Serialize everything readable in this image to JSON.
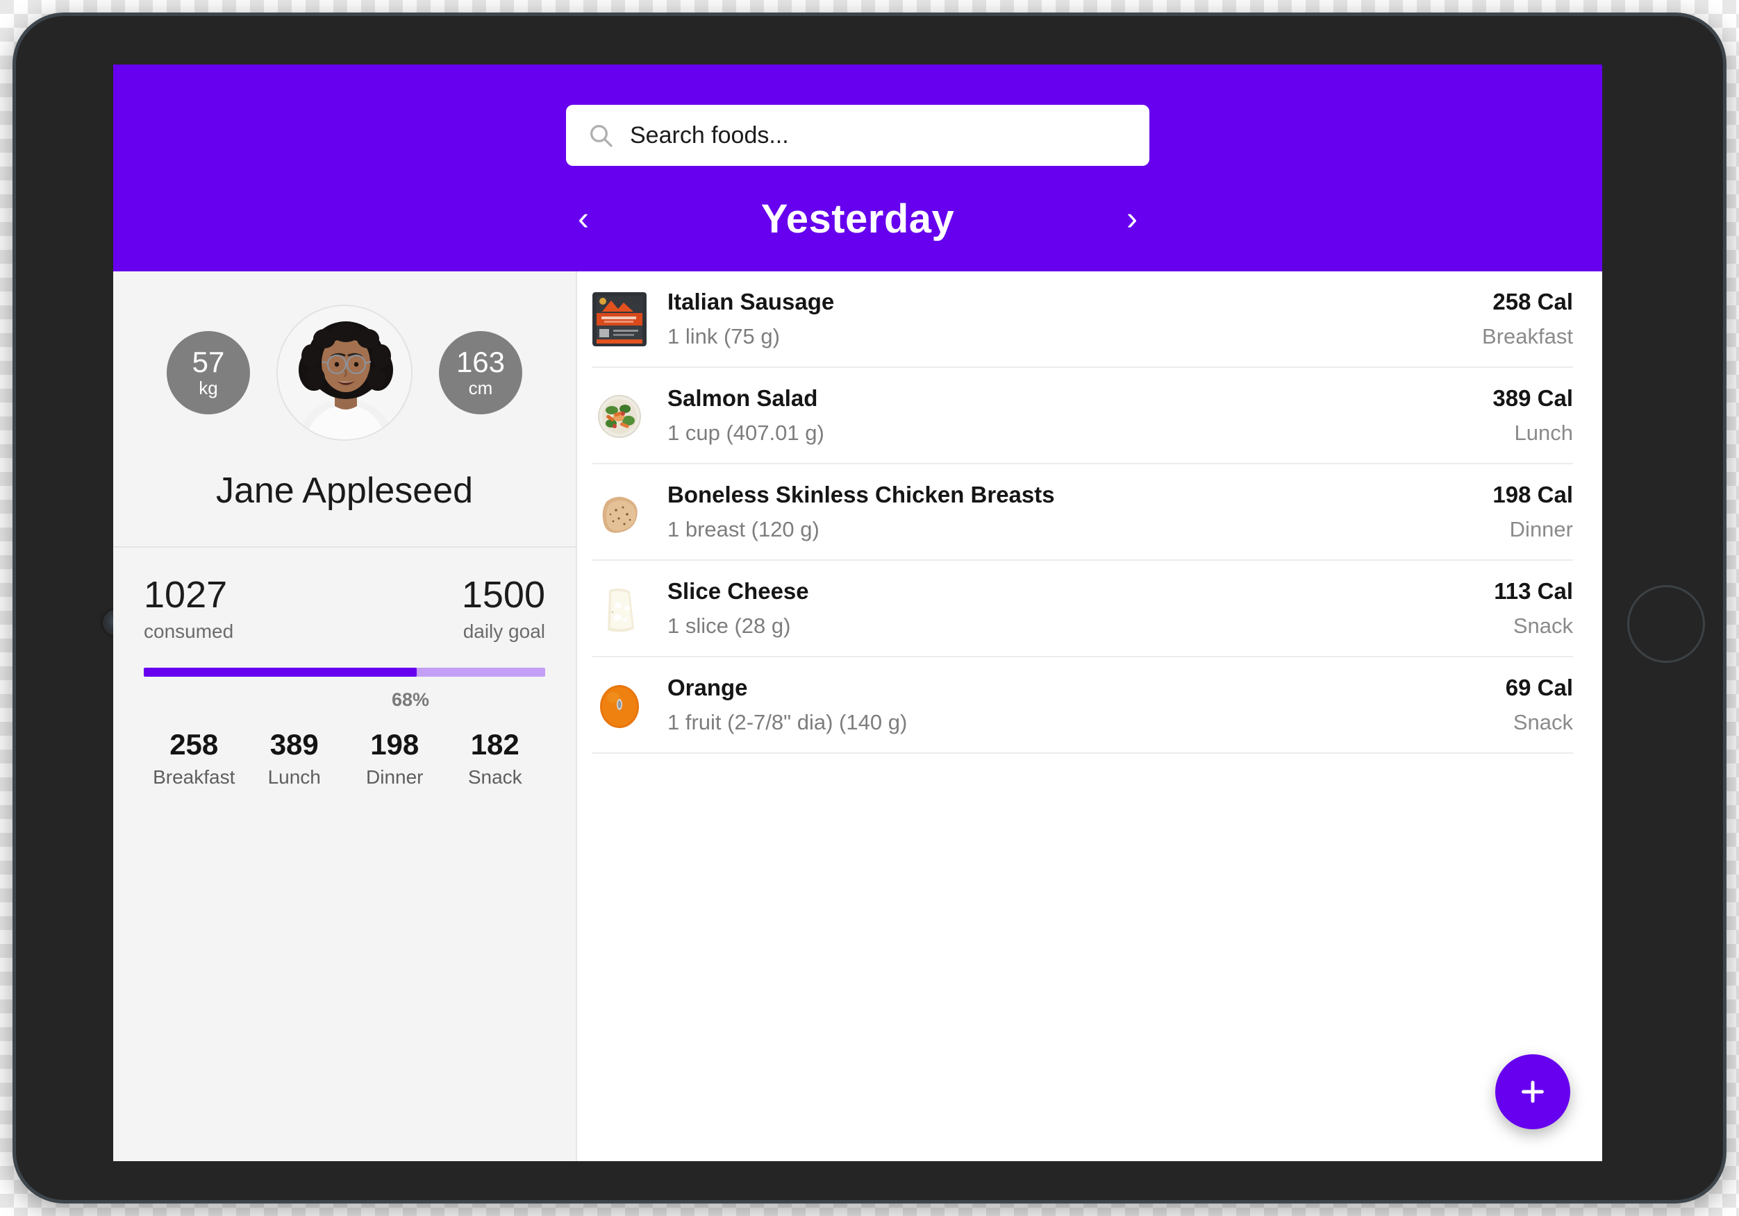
{
  "app": {
    "accent_color": "#6600EE",
    "track_color": "#C3A0F5",
    "bezel_color": "#252526"
  },
  "search": {
    "placeholder": "Search foods...",
    "value": "",
    "icon": "search-icon"
  },
  "datenav": {
    "prev_icon": "chevron-left-icon",
    "next_icon": "chevron-right-icon",
    "prev_label": "‹",
    "next_label": "›",
    "title": "Yesterday"
  },
  "profile": {
    "name": "Jane Appleseed",
    "avatar_name": "user-avatar",
    "weight": {
      "value": "57",
      "unit": "kg"
    },
    "height": {
      "value": "163",
      "unit": "cm"
    }
  },
  "calories": {
    "consumed_value": "1027",
    "consumed_label": "consumed",
    "goal_value": "1500",
    "goal_label": "daily goal",
    "percent_label": "68%",
    "percent": 68,
    "meals": [
      {
        "value": "258",
        "label": "Breakfast"
      },
      {
        "value": "389",
        "label": "Lunch"
      },
      {
        "value": "198",
        "label": "Dinner"
      },
      {
        "value": "182",
        "label": "Snack"
      }
    ]
  },
  "food_log": {
    "items": [
      {
        "name": "Italian Sausage",
        "serving": "1 link (75 g)",
        "calories": "258 Cal",
        "meal": "Breakfast",
        "thumb": "sausage-package-thumbnail"
      },
      {
        "name": "Salmon Salad",
        "serving": "1 cup (407.01 g)",
        "calories": "389 Cal",
        "meal": "Lunch",
        "thumb": "salad-bowl-thumbnail"
      },
      {
        "name": "Boneless Skinless Chicken Breasts",
        "serving": "1 breast (120 g)",
        "calories": "198 Cal",
        "meal": "Dinner",
        "thumb": "chicken-breast-thumbnail"
      },
      {
        "name": "Slice Cheese",
        "serving": "1 slice (28 g)",
        "calories": "113 Cal",
        "meal": "Snack",
        "thumb": "cheese-slice-thumbnail"
      },
      {
        "name": "Orange",
        "serving": "1 fruit (2-7/8\" dia) (140 g)",
        "calories": "69 Cal",
        "meal": "Snack",
        "thumb": "orange-fruit-thumbnail"
      }
    ]
  },
  "fab": {
    "label": "+",
    "icon": "plus-icon"
  }
}
